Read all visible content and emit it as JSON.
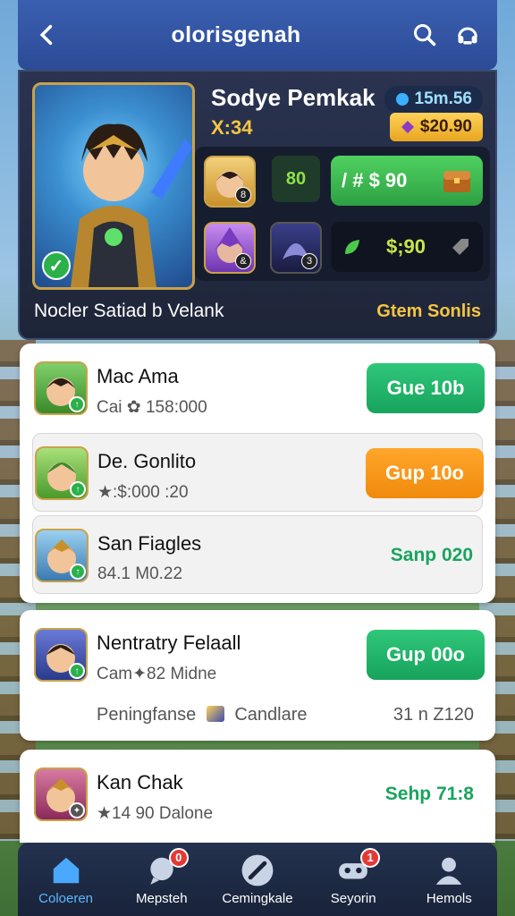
{
  "header": {
    "title": "olorisgenah"
  },
  "hero": {
    "name": "Sodye Pemkak",
    "level": "X:34",
    "gems": "15m.56",
    "gold": "$20.90",
    "item_code": "80",
    "buy_green_label": "/ # $ 90",
    "buy_dark_label": "$;90",
    "footer_left": "Nocler Satiad b Velank",
    "footer_right": "Gtem Sonlis",
    "slot_tags": [
      "8",
      "&",
      "3"
    ]
  },
  "players": [
    {
      "name": "Mac Ama",
      "stat": "Cai ✿ 158:000",
      "action": "Gue 10b",
      "action_style": "green"
    },
    {
      "name": "De. Gonlito",
      "stat": "★:$:000 :20",
      "action": "Gup 10o",
      "action_style": "orange"
    },
    {
      "name": "San Fiagles",
      "stat": "84.1 M0.22",
      "action": "Sanp 020",
      "action_style": "link"
    },
    {
      "name": "Nentratry Felaall",
      "stat": "Cam✦82 Midne",
      "stat2": "Peningfanse",
      "stat2_extra": "Candlare",
      "stat2_right": "31 n Z120",
      "action": "Gup 00o",
      "action_style": "green"
    },
    {
      "name": "Kan Chak",
      "stat": "★14 90 Dalone",
      "action": "Sehp 71:8",
      "action_style": "link"
    }
  ],
  "nav": [
    {
      "label": "Coloeren",
      "icon": "home-icon",
      "active": true
    },
    {
      "label": "Mepsteh",
      "icon": "chat-icon",
      "badge": "0"
    },
    {
      "label": "Cemingkale",
      "icon": "sword-icon"
    },
    {
      "label": "Seyorin",
      "icon": "gamepad-icon",
      "badge": "1"
    },
    {
      "label": "Hemols",
      "icon": "profile-icon"
    }
  ],
  "colors": {
    "accent": "#3a5fb0",
    "green": "#17a35c",
    "orange": "#f08a0c",
    "gold": "#f5c542"
  }
}
